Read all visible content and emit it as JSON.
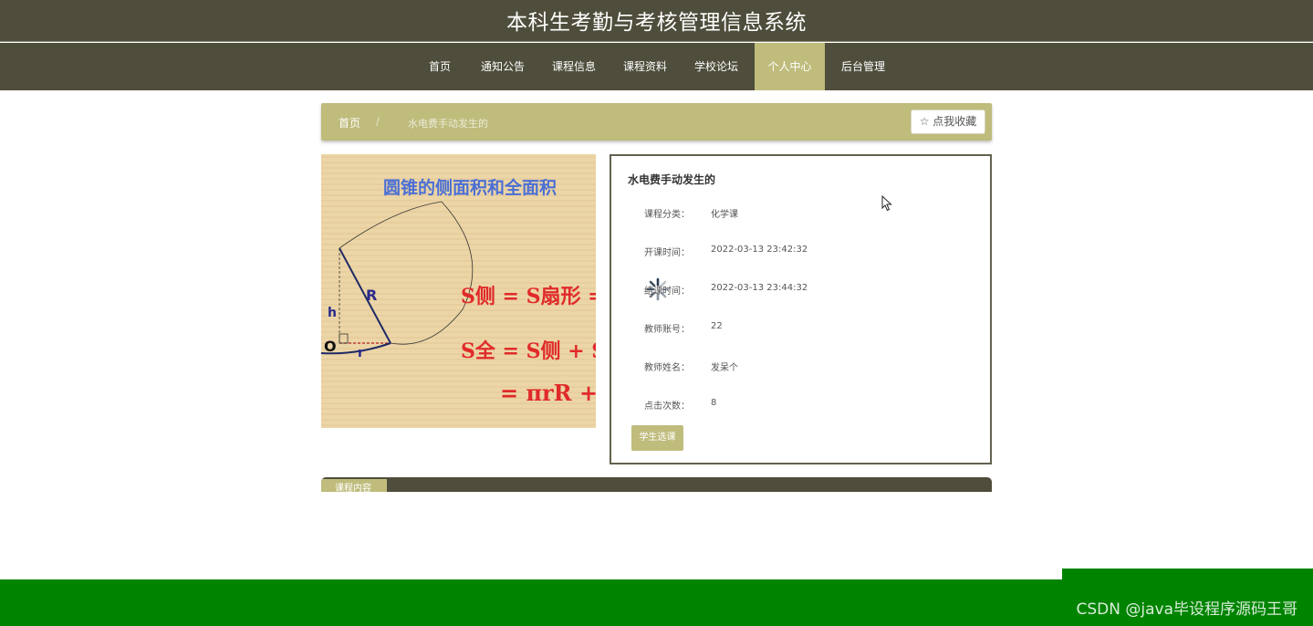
{
  "header": {
    "site_title": "本科生考勤与考核管理信息系统"
  },
  "nav": {
    "items": [
      {
        "label": "首页"
      },
      {
        "label": "通知公告"
      },
      {
        "label": "课程信息"
      },
      {
        "label": "课程资料"
      },
      {
        "label": "学校论坛"
      },
      {
        "label": "个人中心",
        "active": true
      },
      {
        "label": "后台管理"
      }
    ]
  },
  "breadcrumb": {
    "home": "首页",
    "separator": "/",
    "current": "水电费手动发生的"
  },
  "favorite_button": {
    "icon": "star-outline-icon",
    "label": "点我收藏"
  },
  "image": {
    "title": "圆锥的侧面积和全面积",
    "labels": {
      "h": "h",
      "R": "R",
      "O": "O",
      "r": "r"
    },
    "formula1": "S侧 = S扇形 = ",
    "formula2": "S全 = S侧 + S",
    "formula3": "= πrR + "
  },
  "detail": {
    "title": "水电费手动发生的",
    "rows": [
      {
        "label": "课程分类：",
        "value": "化学课"
      },
      {
        "label": "开课时间：",
        "value": "2022-03-13 23:42:32"
      },
      {
        "label": "结课时间：",
        "value": "2022-03-13 23:44:32"
      },
      {
        "label": "教师账号：",
        "value": "22"
      },
      {
        "label": "教师姓名：",
        "value": "发呆个"
      },
      {
        "label": "点击次数：",
        "value": "8"
      }
    ],
    "enroll_button": "学生选课"
  },
  "tabs": {
    "active_label": "课程内容"
  },
  "watermark": "CSDN @java毕设程序源码王哥",
  "colors": {
    "nav_bg": "#4f4d3b",
    "accent": "#bfbc7c",
    "footer": "#008400"
  }
}
